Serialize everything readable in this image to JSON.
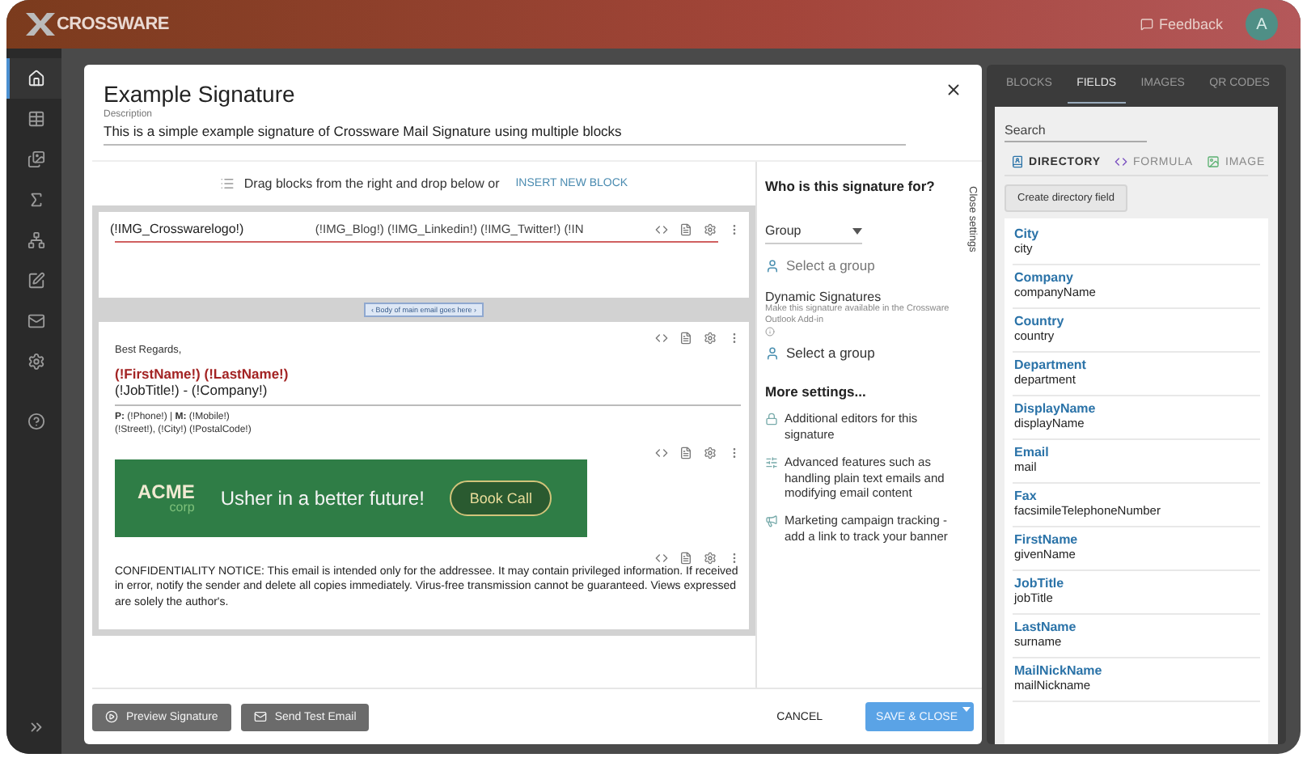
{
  "header": {
    "brand": "CROSSWARE",
    "feedback": "Feedback",
    "avatar": "A"
  },
  "nav": [
    {
      "selected": true
    },
    {
      "selected": false
    },
    {
      "selected": false
    },
    {
      "selected": false
    },
    {
      "selected": false
    },
    {
      "selected": false
    },
    {
      "selected": false
    },
    {
      "selected": false
    },
    {
      "selected": false
    }
  ],
  "modal": {
    "title": "Example Signature",
    "description_label": "Description",
    "description": "This is a simple example signature of Crossware Mail Signature using multiple blocks",
    "editor": {
      "hint": "Drag blocks from the right and drop below or",
      "insert_button": "INSERT NEW BLOCK",
      "header_block": {
        "left": "(!IMG_Crosswarelogo!)",
        "right": "(!IMG_Blog!) (!IMG_Linkedin!) (!IMG_Twitter!) (!IN"
      },
      "body_marker": "‹ Body of main email goes here ›",
      "signature": {
        "greeting": "Best Regards,",
        "name": "(!FirstName!) (!LastName!)",
        "job_line": "(!JobTitle!) - (!Company!)",
        "contact_lines": [
          "**P:** (!Phone!)  |  **M:** (!Mobile!)",
          "(!Street!), (!City!) (!PostalCode!)"
        ],
        "banner": {
          "logo": "ACME",
          "logo_sub": "corp",
          "tagline": "Usher in a better future!",
          "button": "Book Call"
        },
        "disclaimer": "CONFIDENTIALITY NOTICE:  This email is intended only for the addressee. It may contain privileged information. If received in error, notify the sender and delete all copies immediately. Virus-free transmission cannot be guaranteed. Views expressed are solely the author's."
      }
    },
    "settings": {
      "close_tab": "Close settings",
      "heading": "Who is this signature for?",
      "select": "Group",
      "group_picker": "Select a group",
      "dynamic_title": "Dynamic Signatures",
      "dynamic_note": "Make this signature available in the Crossware Outlook Add-in",
      "dynamic_picker": "Select a group",
      "more_heading": "More settings...",
      "more_items": [
        "Additional editors for this signature",
        "Advanced features such as handling plain text emails and modifying email content",
        "Marketing campaign tracking - add a link to track your banner"
      ]
    },
    "footer": {
      "preview": "Preview Signature",
      "test": "Send Test Email",
      "cancel": "CANCEL",
      "save": "SAVE & CLOSE"
    }
  },
  "panel": {
    "tabs": [
      {
        "label": "BLOCKS",
        "selected": false
      },
      {
        "label": "FIELDS",
        "selected": true
      },
      {
        "label": "IMAGES",
        "selected": false
      },
      {
        "label": "QR CODES",
        "selected": false
      }
    ],
    "search": {
      "placeholder": "Search"
    },
    "subtabs": [
      {
        "label": "DIRECTORY",
        "selected": true
      },
      {
        "label": "FORMULA",
        "selected": false
      },
      {
        "label": "IMAGE",
        "selected": false
      }
    ],
    "create_button": "Create directory field",
    "fields": [
      {
        "label": "City",
        "name": "city"
      },
      {
        "label": "Company",
        "name": "companyName"
      },
      {
        "label": "Country",
        "name": "country"
      },
      {
        "label": "Department",
        "name": "department"
      },
      {
        "label": "DisplayName",
        "name": "displayName"
      },
      {
        "label": "Email",
        "name": "mail"
      },
      {
        "label": "Fax",
        "name": "facsimileTelephoneNumber"
      },
      {
        "label": "FirstName",
        "name": "givenName"
      },
      {
        "label": "JobTitle",
        "name": "jobTitle"
      },
      {
        "label": "LastName",
        "name": "surname"
      },
      {
        "label": "MailNickName",
        "name": "mailNickname"
      }
    ]
  }
}
